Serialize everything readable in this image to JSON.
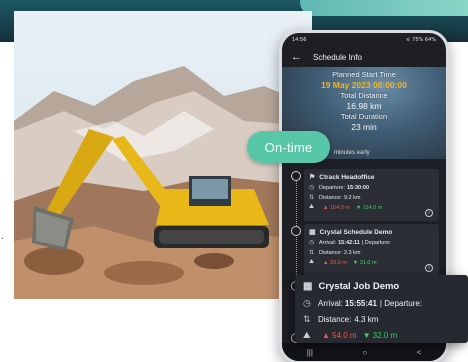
{
  "colors": {
    "accent_teal": "#57c7a8",
    "date_yellow": "#f2b426",
    "header_dark": "#173d47",
    "up_red": "#f05a4f",
    "down_green": "#3ccf6b"
  },
  "side_mark": ".",
  "status_bar": {
    "time": "14:56",
    "right": "⚟ 75% 64%"
  },
  "app_bar": {
    "back_icon": "arrow-left-icon",
    "title": "Schedule Info"
  },
  "summary": {
    "planned_start_label": "Planned Start Time",
    "planned_start_value": "19 May 2023 08:00:00",
    "distance_label": "Total Distance",
    "distance_value": "16.98 km",
    "duration_label": "Total Duration",
    "duration_value": "23 min",
    "early_text": "minutes early"
  },
  "badge": {
    "label": "On-time"
  },
  "stops": [
    {
      "title": "Ctrack Headoffice",
      "icon": "flag-icon",
      "time_label": "Departure:",
      "time_value": "15:30:00",
      "distance_label": "Distance:",
      "distance_value": "9.2 km",
      "elev_up": "▲ 164.0 m",
      "elev_down": "▼ 114.0 m"
    },
    {
      "title": "Crystal Schedule Demo",
      "icon": "building-icon",
      "time_label": "Arrival:",
      "time_value": "15:42:11",
      "extra": "| Departure:",
      "distance_label": "Distance:",
      "distance_value": "2.3 km",
      "elev_up": "▲ 33.0 m",
      "elev_down": "▼ 31.0 m"
    }
  ],
  "popout": {
    "title": "Crystal Job Demo",
    "icon": "building-icon",
    "arrival_label": "Arrival:",
    "arrival_value": "15:55:41",
    "extra": "| Departure:",
    "distance_label": "Distance:",
    "distance_value": "4.3 km",
    "elev_up": "▲ 54.0 m",
    "elev_down": "▼ 32.0 m"
  },
  "nav": {
    "recent": "|||",
    "home": "○",
    "back": "<"
  }
}
